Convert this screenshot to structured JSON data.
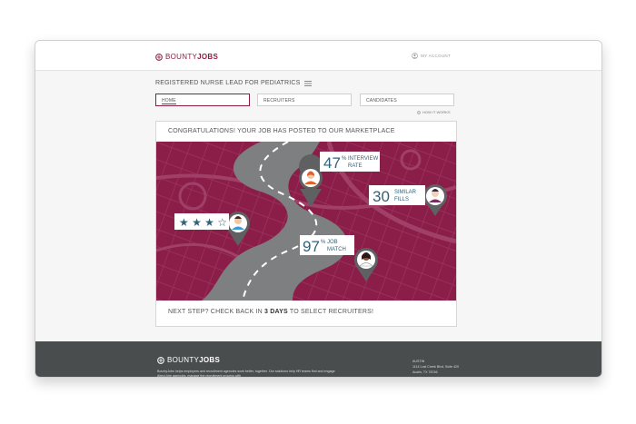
{
  "header": {
    "logo_light": "BOUNTY",
    "logo_bold": "JOBS",
    "account_label": "MY ACCOUNT"
  },
  "job": {
    "title": "REGISTERED NURSE LEAD FOR PEDIATRICS"
  },
  "tabs": [
    {
      "label": "HOME",
      "active": true
    },
    {
      "label": "RECRUITERS",
      "active": false
    },
    {
      "label": "CANDIDATES",
      "active": false
    }
  ],
  "how_it_works": "HOW IT WORKS",
  "card": {
    "heading": "CONGRATULATIONS! YOUR JOB HAS POSTED TO OUR MARKETPLACE",
    "footer_prefix": "NEXT STEP? CHECK BACK IN ",
    "footer_bold": "3 DAYS",
    "footer_suffix": " TO SELECT RECRUITERS!"
  },
  "stats": {
    "interview_value": "47",
    "interview_unit": "%",
    "interview_label_1": "INTERVIEW",
    "interview_label_2": "RATE",
    "similar_value": "30",
    "similar_label_1": "SIMILAR",
    "similar_label_2": "FILLS",
    "match_value": "97",
    "match_unit": "%",
    "match_label_1": "JOB",
    "match_label_2": "MATCH",
    "rating_stars": 3,
    "rating_max": 4,
    "star_filled": "★",
    "star_empty": "☆"
  },
  "footer": {
    "logo_light": "BOUNTY",
    "logo_bold": "JOBS",
    "description": "BountyJobs helps employers and recruitment agencies work better, together. Our solutions help HR teams find and engage direct-hire agencies, manage the recruitment process with",
    "city": "AUSTIN",
    "address_1": "1114 Lost Creek Blvd, Suite 420",
    "address_2": "Austin, TX 78746"
  },
  "colors": {
    "brand": "#8b1d45",
    "hero_bg": "#8a1e49",
    "road": "#7d7f80",
    "footer_bg": "#4a4d4e"
  }
}
